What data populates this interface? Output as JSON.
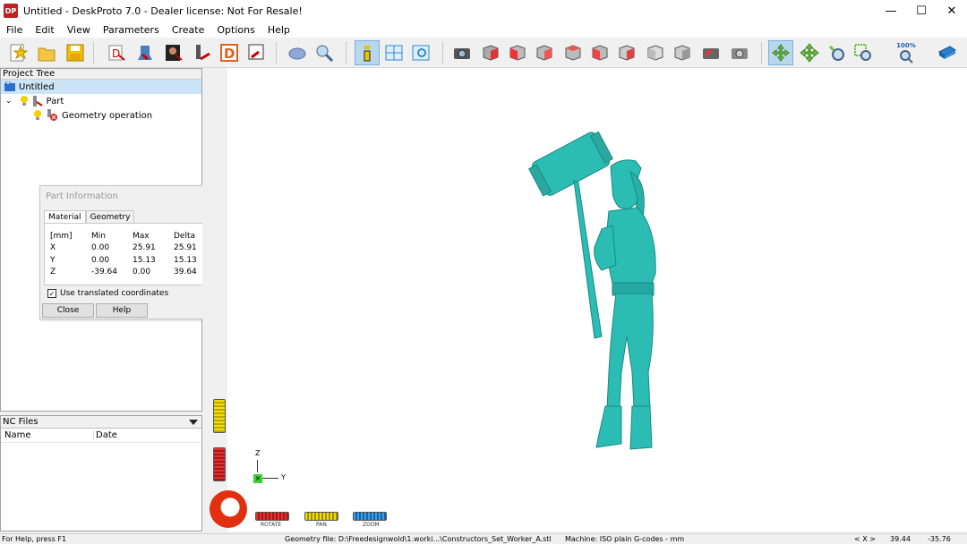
{
  "window": {
    "app_icon": "DP",
    "title": "Untitled - DeskProto 7.0 - Dealer license: Not For Resale!",
    "controls": [
      "—",
      "☐",
      "✕"
    ]
  },
  "menu": [
    "File",
    "Edit",
    "View",
    "Parameters",
    "Create",
    "Options",
    "Help"
  ],
  "toolbar": {
    "zoom_percent": "100%",
    "icons": [
      "new-project-icon",
      "open-icon",
      "save-icon",
      "part-wizard-icon",
      "create-nc-icon",
      "part-image-icon",
      "operation-icon",
      "d-wizard-icon",
      "export-icon",
      "load-geometry-icon",
      "view-parameters-icon",
      "info-icon",
      "layout-icon",
      "preview-icon",
      "camera-icon",
      "view-iso-icon",
      "view-front-icon",
      "view-right-icon",
      "view-back-icon",
      "view-left-icon",
      "view-top-icon",
      "view-bottom-icon",
      "view-3d-icon",
      "view-box-icon",
      "render-icon",
      "print-icon",
      "rotate-icon",
      "pan-icon",
      "zoom-icon",
      "zoom-window-icon",
      "zoom-100-icon",
      "book-icon"
    ]
  },
  "project_tree": {
    "header": "Project Tree",
    "items": [
      {
        "label": "Untitled",
        "level": 0,
        "selected": true
      },
      {
        "label": "Part",
        "level": 1,
        "selected": false
      },
      {
        "label": "Geometry operation",
        "level": 2,
        "selected": false
      }
    ]
  },
  "part_info": {
    "title": "Part Information",
    "tabs": [
      "Material",
      "Geometry"
    ],
    "active_tab": "Material",
    "headers": [
      "[mm]",
      "Min",
      "Max",
      "Delta"
    ],
    "rows": [
      [
        "X",
        "0.00",
        "25.91",
        "25.91"
      ],
      [
        "Y",
        "0.00",
        "15.13",
        "15.13"
      ],
      [
        "Z",
        "-39.64",
        "0.00",
        "39.64"
      ]
    ],
    "checkbox_label": "Use translated coordinates",
    "checkbox_checked": true,
    "close_label": "Close",
    "help_label": "Help"
  },
  "nc_files": {
    "header": "NC Files",
    "columns": [
      "Name",
      "Date"
    ]
  },
  "viewport": {
    "axis_z": "Z",
    "axis_y": "Y",
    "model_color": "#2bbcb4",
    "sliders": [
      "ROTATE",
      "PAN",
      "ZOOM"
    ]
  },
  "status": {
    "help": "For Help, press F1",
    "geometry_file": "Geometry file: D:\\Freedesignwold\\1.worki...\\Constructors_Set_Worker_A.stl",
    "machine": "Machine: ISO plain G-codes - mm",
    "coord_label": "< X >",
    "x": "39.44",
    "y": "-35.76"
  }
}
